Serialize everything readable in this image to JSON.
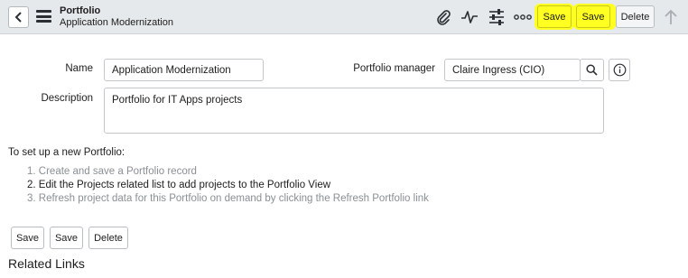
{
  "header": {
    "title": "Portfolio",
    "subtitle": "Application Modernization",
    "save_label_1": "Save",
    "save_label_2": "Save",
    "delete_label": "Delete",
    "icons": [
      "back-icon",
      "hamburger-icon",
      "paperclip-icon",
      "activity-icon",
      "sliders-icon",
      "more-icon",
      "up-arrow-icon"
    ]
  },
  "form": {
    "name_label": "Name",
    "name_value": "Application Modernization",
    "manager_label": "Portfolio manager",
    "manager_value": "Claire Ingress (CIO)",
    "description_label": "Description",
    "description_value": "Portfolio for IT Apps projects"
  },
  "instructions": {
    "intro": "To set up a new Portfolio:",
    "steps": [
      "1. Create and save a Portfolio record",
      "2. Edit the Projects related list to add projects to the Portfolio View",
      "3. Refresh project data for this Portfolio on demand by clicking the Refresh Portfolio link"
    ]
  },
  "footer": {
    "save_label_1": "Save",
    "save_label_2": "Save",
    "delete_label": "Delete"
  },
  "related_links": "Related Links",
  "colors": {
    "header_bg": "#e6e9eb",
    "highlight": "#ffff22",
    "muted_text": "#8a8f94"
  }
}
